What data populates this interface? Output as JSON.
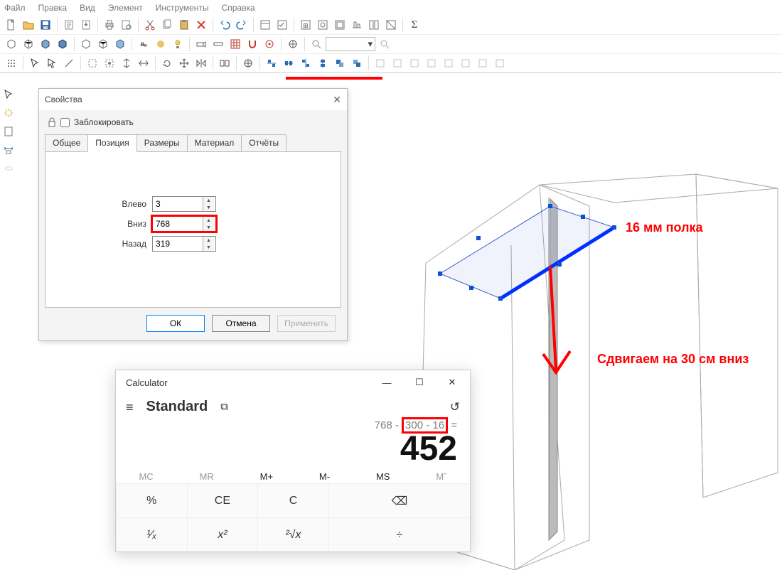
{
  "menu": [
    "Файл",
    "Правка",
    "Вид",
    "Элемент",
    "Инструменты",
    "Справка"
  ],
  "props": {
    "title": "Свойства",
    "lock_label": "Заблокировать",
    "tabs": [
      "Общее",
      "Позиция",
      "Размеры",
      "Материал",
      "Отчёты"
    ],
    "active_tab": 1,
    "fields": {
      "left": {
        "label": "Влево",
        "value": "3"
      },
      "down": {
        "label": "Вниз",
        "value": "768"
      },
      "back": {
        "label": "Назад",
        "value": "319"
      }
    },
    "buttons": {
      "ok": "ОК",
      "cancel": "Отмена",
      "apply": "Применить"
    }
  },
  "calc": {
    "title": "Calculator",
    "mode": "Standard",
    "expr_plain_pre": "768 - ",
    "expr_hl": "300 - 16",
    "result": "452",
    "mem": [
      "MC",
      "MR",
      "M+",
      "M-",
      "MS",
      "Mˇ"
    ],
    "keys_row1": [
      "%",
      "CE",
      "C",
      "⌫"
    ],
    "keys_row2": [
      "¹⁄ₓ",
      "x²",
      "²√x",
      "÷"
    ]
  },
  "anno": {
    "shelf": "16 мм полка",
    "move": "Сдвигаем на 30 см вниз"
  }
}
